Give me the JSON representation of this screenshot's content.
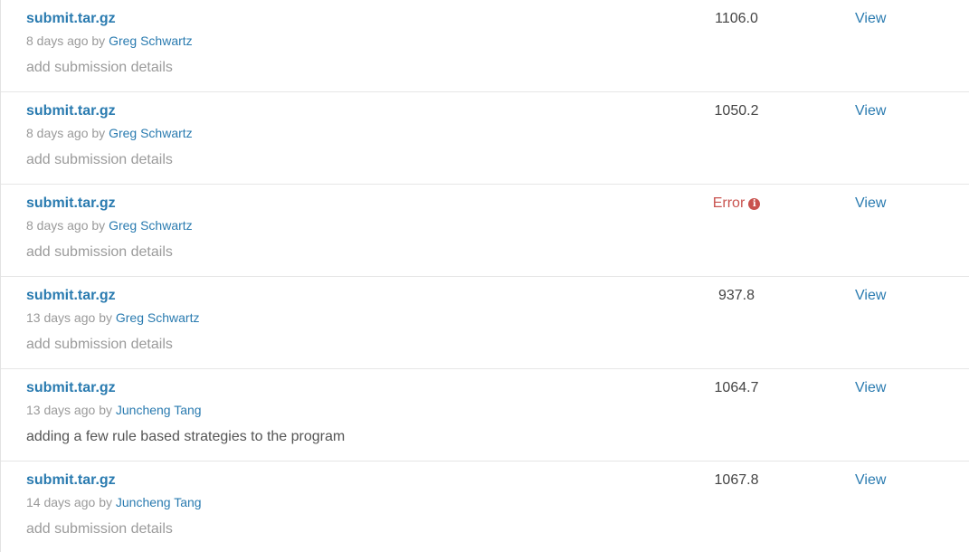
{
  "submissions": [
    {
      "filename": "submit.tar.gz",
      "age": "8 days ago",
      "by": "by",
      "author": "Greg Schwartz",
      "details": "add submission details",
      "score": "1106.0",
      "view": "View"
    },
    {
      "filename": "submit.tar.gz",
      "age": "8 days ago",
      "by": "by",
      "author": "Greg Schwartz",
      "details": "add submission details",
      "score": "1050.2",
      "view": "View"
    },
    {
      "filename": "submit.tar.gz",
      "age": "8 days ago",
      "by": "by",
      "author": "Greg Schwartz",
      "details": "add submission details",
      "score": "Error",
      "score_icon": "info-icon",
      "view": "View"
    },
    {
      "filename": "submit.tar.gz",
      "age": "13 days ago",
      "by": "by",
      "author": "Greg Schwartz",
      "details": "add submission details",
      "score": "937.8",
      "view": "View"
    },
    {
      "filename": "submit.tar.gz",
      "age": "13 days ago",
      "by": "by",
      "author": "Juncheng Tang",
      "details": "adding a few rule based strategies to the program",
      "score": "1064.7",
      "view": "View"
    },
    {
      "filename": "submit.tar.gz",
      "age": "14 days ago",
      "by": "by",
      "author": "Juncheng Tang",
      "details": "add submission details",
      "score": "1067.8",
      "view": "View"
    }
  ],
  "colors": {
    "link": "#2a7bb0",
    "muted": "#9a9a9a",
    "error": "#c9534f",
    "divider": "#e6e6e6"
  },
  "icons": {
    "error_info": "i"
  }
}
